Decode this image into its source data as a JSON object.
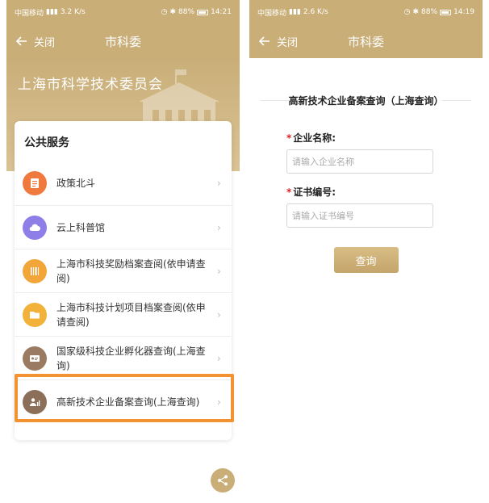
{
  "colors": {
    "brand": "#c9ae78",
    "highlight": "#f39230",
    "required": "#e02020"
  },
  "left": {
    "status": {
      "carrier": "中国移动",
      "speed": "3.2 K/s",
      "battery": "88%",
      "time": "14:21"
    },
    "nav": {
      "close_label": "关闭",
      "title": "市科委"
    },
    "hero_title": "上海市科学技术委员会",
    "card_title": "公共服务",
    "services": [
      {
        "label": "政策北斗",
        "icon": "document-icon",
        "color": "#f07a3e"
      },
      {
        "label": "云上科普馆",
        "icon": "cloud-icon",
        "color": "#8e7ee8"
      },
      {
        "label": "上海市科技奖励档案查阅(依申请查阅)",
        "icon": "barcode-icon",
        "color": "#f2a63a"
      },
      {
        "label": "上海市科技计划项目档案查阅(依申请查阅)",
        "icon": "folder-icon",
        "color": "#f2b23a"
      },
      {
        "label": "国家级科技企业孵化器查询(上海查询)",
        "icon": "id-card-icon",
        "color": "#9a7a60"
      },
      {
        "label": "高新技术企业备案查询(上海查询)",
        "icon": "chart-user-icon",
        "color": "#8c6f58"
      }
    ]
  },
  "right": {
    "status": {
      "carrier": "中国移动",
      "speed": "2.6 K/s",
      "battery": "88%",
      "time": "14:19"
    },
    "nav": {
      "close_label": "关闭",
      "title": "市科委"
    },
    "form_title": "高新技术企业备案查询（上海查询）",
    "company_label": "企业名称:",
    "company_placeholder": "请输入企业名称",
    "cert_label": "证书编号:",
    "cert_placeholder": "请输入证书编号",
    "required_mark": "*",
    "query_button": "查询"
  }
}
